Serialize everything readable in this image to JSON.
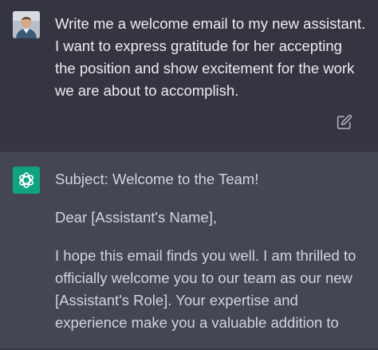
{
  "user_message": {
    "text": "Write me a welcome email to my new assistant. I want to express gratitude for her accepting the position and show excitement for the work we are about to accomplish.",
    "avatar_icon": "user-avatar",
    "edit_icon": "edit-icon"
  },
  "assistant_message": {
    "icon": "openai-logo-icon",
    "accent_color": "#10a37f",
    "paragraphs": [
      "Subject: Welcome to the Team!",
      "Dear [Assistant's Name],",
      "I hope this email finds you well. I am thrilled to officially welcome you to our team as our new [Assistant's Role]. Your expertise and experience make you a valuable addition to"
    ]
  },
  "colors": {
    "user_bg": "#343541",
    "assistant_bg": "#444654",
    "text": "#ececf1"
  }
}
